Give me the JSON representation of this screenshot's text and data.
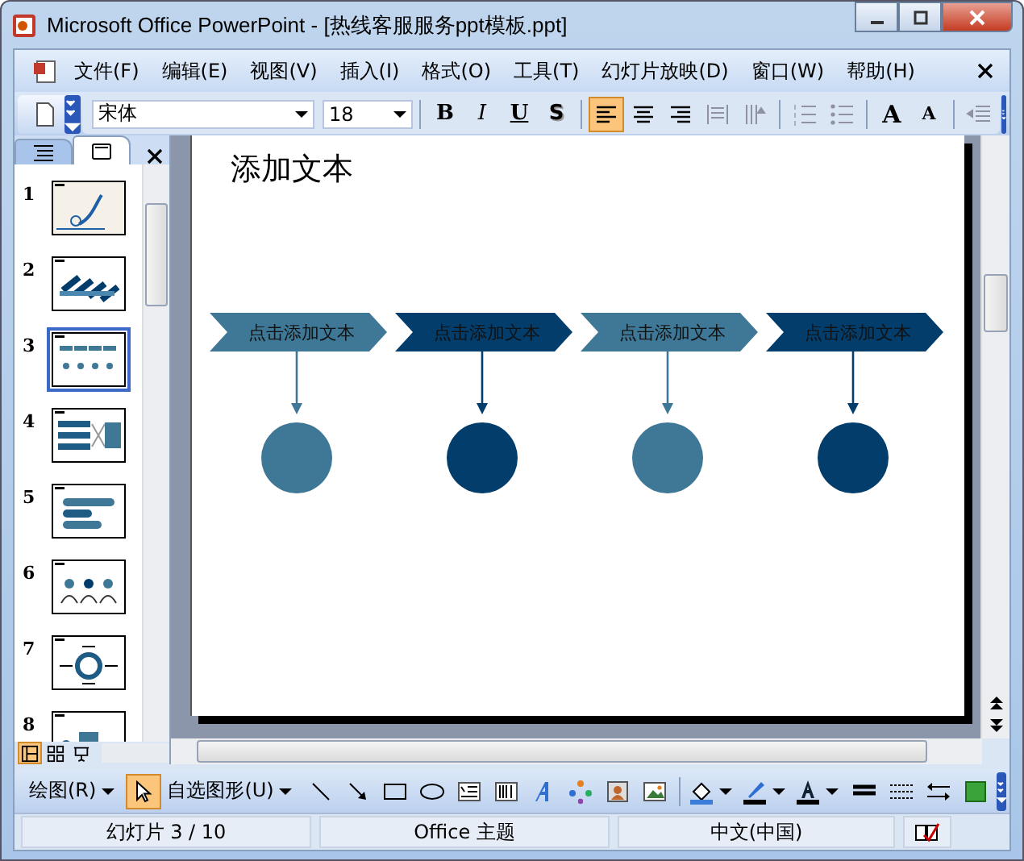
{
  "window": {
    "title": "Microsoft Office PowerPoint - [热线客服服务ppt模板.ppt]"
  },
  "menu": [
    "文件(F)",
    "编辑(E)",
    "视图(V)",
    "插入(I)",
    "格式(O)",
    "工具(T)",
    "幻灯片放映(D)",
    "窗口(W)",
    "帮助(H)"
  ],
  "format_toolbar": {
    "font": "宋体",
    "size": "18",
    "style_buttons": [
      {
        "label": "B",
        "kind": "bold"
      },
      {
        "label": "I",
        "kind": "italic"
      },
      {
        "label": "U",
        "kind": "underline"
      },
      {
        "label": "S",
        "kind": "shadow"
      }
    ],
    "align_buttons": [
      {
        "kind": "left",
        "selected": true
      },
      {
        "kind": "center",
        "selected": false
      },
      {
        "kind": "right",
        "selected": false
      }
    ],
    "grow_buttons": [
      {
        "label": "A",
        "kind": "grow"
      },
      {
        "label": "A",
        "kind": "shrink"
      }
    ]
  },
  "pane": {
    "tabs": [
      {
        "kind": "outline",
        "selected": false
      },
      {
        "kind": "slides",
        "selected": true
      }
    ],
    "slides": [
      {
        "number": "1",
        "kind": "phone",
        "selected": false
      },
      {
        "number": "2",
        "kind": "diagonal",
        "selected": false
      },
      {
        "number": "3",
        "kind": "steps",
        "selected": true
      },
      {
        "number": "4",
        "kind": "bars",
        "selected": false
      },
      {
        "number": "5",
        "kind": "pills",
        "selected": false
      },
      {
        "number": "6",
        "kind": "people",
        "selected": false
      },
      {
        "number": "7",
        "kind": "ring",
        "selected": false
      },
      {
        "number": "8",
        "kind": "dots",
        "selected": false
      }
    ],
    "views": [
      {
        "kind": "normal",
        "selected": true
      },
      {
        "kind": "sorter",
        "selected": false
      },
      {
        "kind": "show",
        "selected": false
      }
    ]
  },
  "slide": {
    "title": "添加文本",
    "steps": [
      {
        "label": "点击添加文本",
        "color": "#3f7896"
      },
      {
        "label": "点击添加文本",
        "color": "#023d6b"
      },
      {
        "label": "点击添加文本",
        "color": "#3f7896"
      },
      {
        "label": "点击添加文本",
        "color": "#023d6b"
      }
    ]
  },
  "drawing_toolbar": {
    "draw_menu": "绘图(R)",
    "autoshapes_menu": "自选图形(U)",
    "tools": [
      {
        "kind": "pointer",
        "selected": true
      },
      {
        "kind": "line",
        "selected": false
      },
      {
        "kind": "arrow",
        "selected": false
      },
      {
        "kind": "rectangle",
        "selected": false
      },
      {
        "kind": "ellipse",
        "selected": false
      },
      {
        "kind": "textbox",
        "selected": false
      },
      {
        "kind": "vtextbox",
        "selected": false
      },
      {
        "kind": "wordart",
        "selected": false
      },
      {
        "kind": "diagram",
        "selected": false
      },
      {
        "kind": "clipart",
        "selected": false
      },
      {
        "kind": "image",
        "selected": false
      },
      {
        "kind": "fill",
        "selected": false
      },
      {
        "kind": "linecolor",
        "selected": false
      },
      {
        "kind": "fontcolor",
        "selected": false
      },
      {
        "kind": "linestyle",
        "selected": false
      },
      {
        "kind": "dashstyle",
        "selected": false
      },
      {
        "kind": "arrowstyle",
        "selected": false
      },
      {
        "kind": "depth",
        "selected": false
      }
    ]
  },
  "status_bar": {
    "slide": "幻灯片 3 / 10",
    "theme": "Office 主题",
    "language": "中文(中国)"
  }
}
